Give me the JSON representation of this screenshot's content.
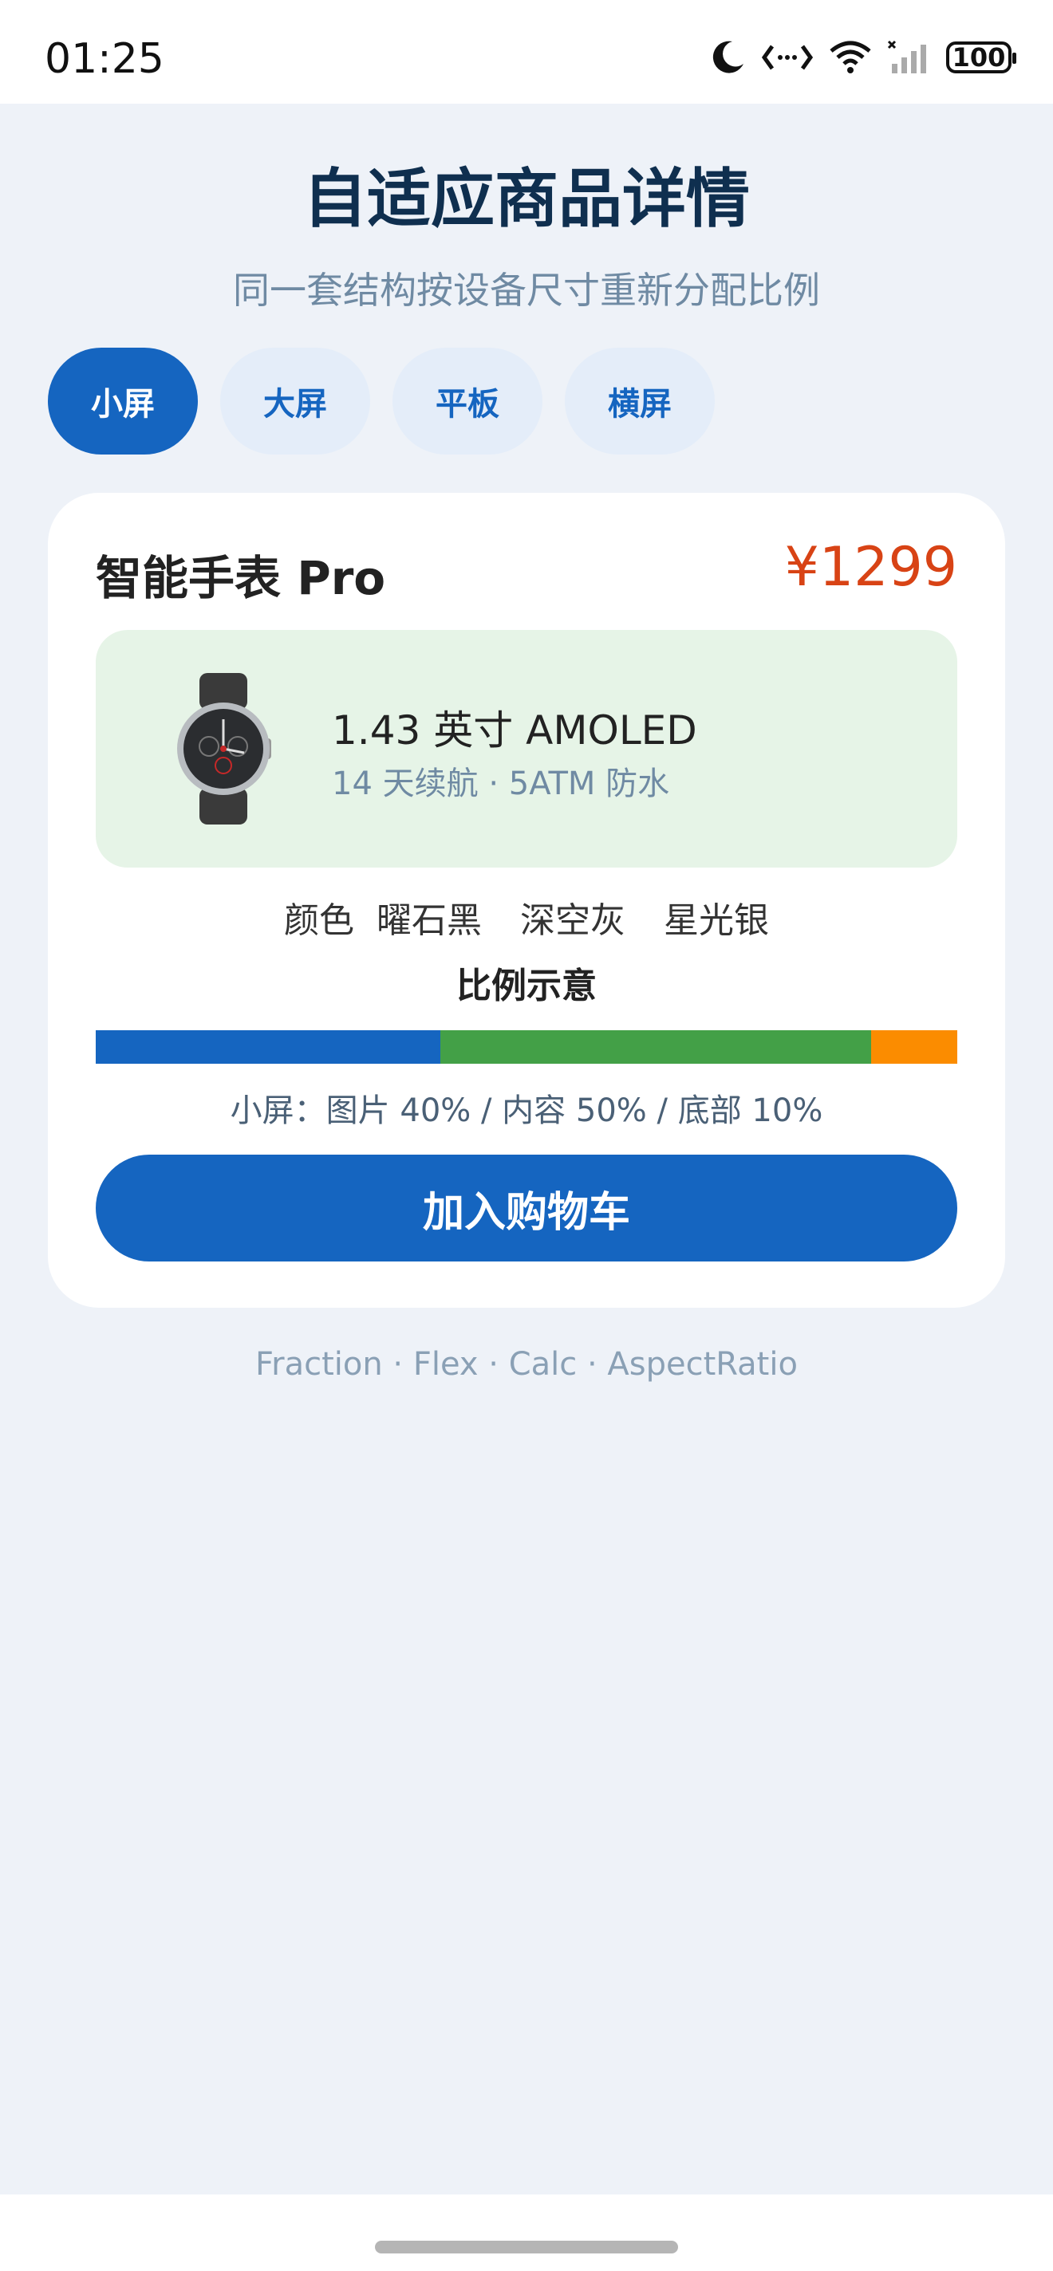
{
  "status_bar": {
    "time": "01:25",
    "battery": "100"
  },
  "header": {
    "title": "自适应商品详情",
    "subtitle": "同一套结构按设备尺寸重新分配比例"
  },
  "tabs": [
    {
      "label": "小屏",
      "active": true
    },
    {
      "label": "大屏",
      "active": false
    },
    {
      "label": "平板",
      "active": false
    },
    {
      "label": "横屏",
      "active": false
    }
  ],
  "product": {
    "name": "智能手表 Pro",
    "price": "¥1299",
    "spec_main": "1.43 英寸 AMOLED",
    "spec_sub": "14 天续航 · 5ATM 防水",
    "color_label": "颜色",
    "colors": [
      "曜石黑",
      "深空灰",
      "星光银"
    ]
  },
  "ratio": {
    "title": "比例示意",
    "segments": [
      {
        "name": "图片",
        "percent": 40,
        "color": "#1565c0"
      },
      {
        "name": "内容",
        "percent": 50,
        "color": "#43a047"
      },
      {
        "name": "底部",
        "percent": 10,
        "color": "#fb8c00"
      }
    ],
    "text": "小屏：图片 40% / 内容 50% / 底部 10%"
  },
  "cart_button": "加入购物车",
  "footer": "Fraction · Flex · Calc · AspectRatio",
  "theme": {
    "accent": "#1565c0",
    "price_color": "#d84315",
    "background": "#eef2f8"
  }
}
